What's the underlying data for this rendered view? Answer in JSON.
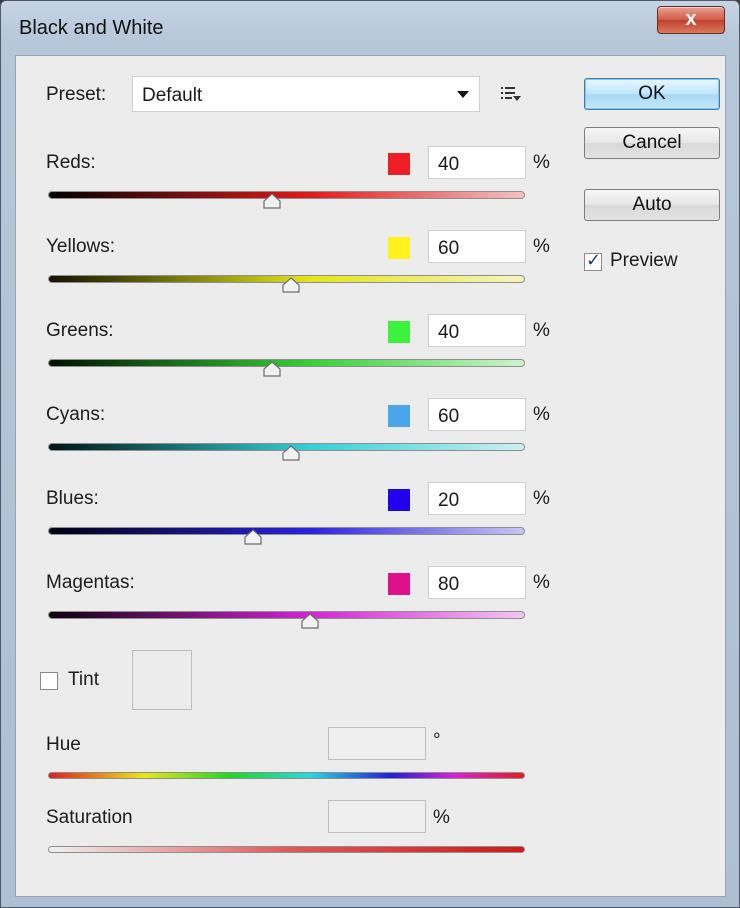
{
  "window": {
    "title": "Black and White",
    "close_glyph": "x"
  },
  "preset": {
    "label": "Preset:",
    "value": "Default",
    "menu_icon": "list-menu-icon"
  },
  "buttons": {
    "ok": "OK",
    "cancel": "Cancel",
    "auto": "Auto"
  },
  "preview": {
    "label": "Preview",
    "checked": true,
    "check_glyph": "✓"
  },
  "sliders": [
    {
      "label": "Reds:",
      "value": "40",
      "unit": "%",
      "color": "#ee1f24",
      "gradient": [
        "#000000",
        "#e21a1a",
        "#f2c2c2"
      ],
      "level": 0.47
    },
    {
      "label": "Yellows:",
      "value": "60",
      "unit": "%",
      "color": "#fff21f",
      "gradient": [
        "#111100",
        "#e5e51a",
        "#f7f3c0"
      ],
      "level": 0.51
    },
    {
      "label": "Greens:",
      "value": "40",
      "unit": "%",
      "color": "#3cf23c",
      "gradient": [
        "#001000",
        "#37d037",
        "#cdf4cd"
      ],
      "level": 0.47
    },
    {
      "label": "Cyans:",
      "value": "60",
      "unit": "%",
      "color": "#4aa6e8",
      "gradient": [
        "#001414",
        "#34d0d8",
        "#cdf0f4"
      ],
      "level": 0.51
    },
    {
      "label": "Blues:",
      "value": "20",
      "unit": "%",
      "color": "#2200ee",
      "gradient": [
        "#000010",
        "#2a23e0",
        "#c9c6f4"
      ],
      "level": 0.43
    },
    {
      "label": "Magentas:",
      "value": "80",
      "unit": "%",
      "color": "#e0108c",
      "gradient": [
        "#100010",
        "#d523d5",
        "#f4c6f4"
      ],
      "level": 0.55
    }
  ],
  "tint": {
    "label": "Tint",
    "checked": false
  },
  "hue": {
    "label": "Hue",
    "value": "",
    "unit": "°"
  },
  "saturation": {
    "label": "Saturation",
    "value": "",
    "unit": "%"
  }
}
